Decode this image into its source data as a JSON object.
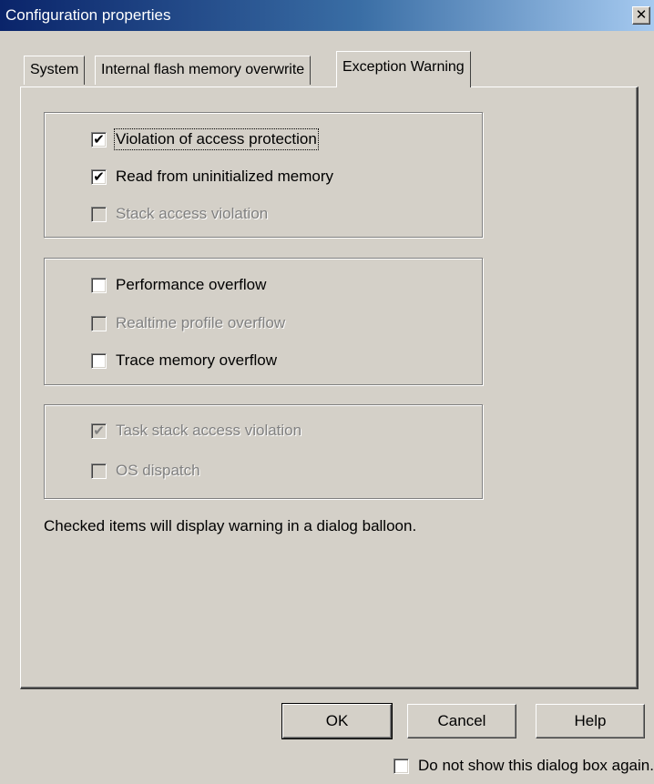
{
  "window": {
    "title": "Configuration properties",
    "close_glyph": "✕"
  },
  "tabs": [
    {
      "label": "System",
      "active": false
    },
    {
      "label": "Internal flash memory overwrite",
      "active": false
    },
    {
      "label": "Exception Warning",
      "active": true
    }
  ],
  "groups": [
    {
      "items": [
        {
          "label": "Violation of access protection",
          "checked": true,
          "enabled": true,
          "focused": true
        },
        {
          "label": "Read from uninitialized memory",
          "checked": true,
          "enabled": true
        },
        {
          "label": "Stack access violation",
          "checked": false,
          "enabled": false
        }
      ]
    },
    {
      "items": [
        {
          "label": "Performance overflow",
          "checked": false,
          "enabled": true
        },
        {
          "label": "Realtime profile overflow",
          "checked": false,
          "enabled": false
        },
        {
          "label": "Trace memory overflow",
          "checked": false,
          "enabled": true
        }
      ]
    },
    {
      "items": [
        {
          "label": "Task stack access violation",
          "checked": true,
          "enabled": false
        },
        {
          "label": "OS dispatch",
          "checked": false,
          "enabled": false
        }
      ]
    }
  ],
  "note": "Checked items will display warning in a dialog balloon.",
  "buttons": {
    "ok": "OK",
    "cancel": "Cancel",
    "help": "Help"
  },
  "dont_show": {
    "label": "Do not show this dialog box again.",
    "checked": false
  },
  "check_glyph": "✔"
}
